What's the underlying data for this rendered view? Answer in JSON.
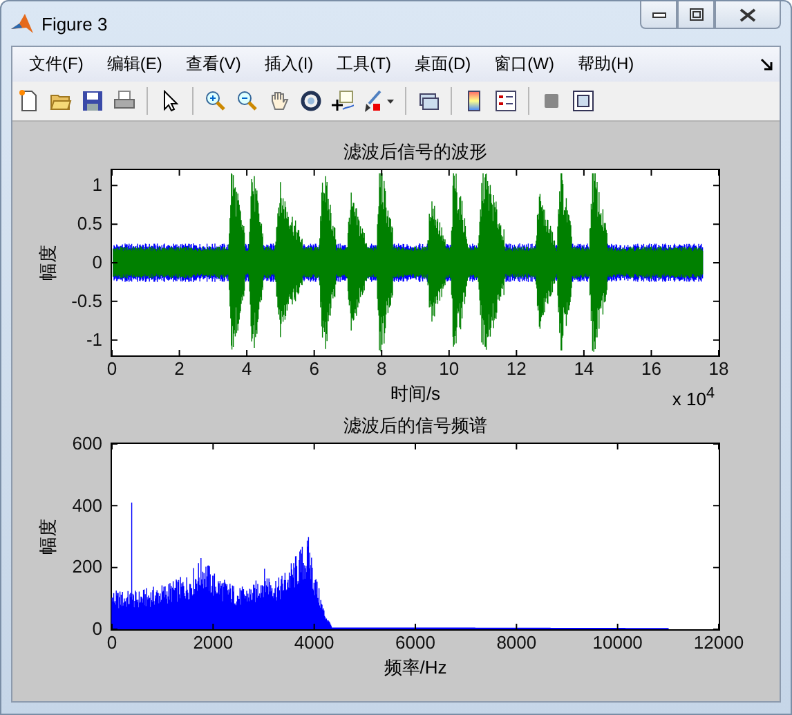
{
  "window": {
    "title": "Figure 3"
  },
  "menu": [
    "文件(F)",
    "编辑(E)",
    "查看(V)",
    "插入(I)",
    "工具(T)",
    "桌面(D)",
    "窗口(W)",
    "帮助(H)"
  ],
  "plots": [
    {
      "kind": "waveform",
      "title": "滤波后信号的波形",
      "xlabel": "时间/s",
      "ylabel": "幅度",
      "exponent": "x 10$^{4}$",
      "xticks": [
        "0",
        "2",
        "4",
        "6",
        "8",
        "10",
        "12",
        "14",
        "16",
        "18"
      ],
      "yticks": [
        "1",
        "0.5",
        "0",
        "-0.5",
        "-1"
      ]
    },
    {
      "kind": "spectrum",
      "title": "滤波后的信号频谱",
      "xlabel": "频率/Hz",
      "ylabel": "幅度",
      "xticks": [
        "0",
        "2000",
        "4000",
        "6000",
        "8000",
        "10000",
        "12000"
      ],
      "yticks": [
        "600",
        "400",
        "200",
        "0"
      ]
    }
  ]
}
